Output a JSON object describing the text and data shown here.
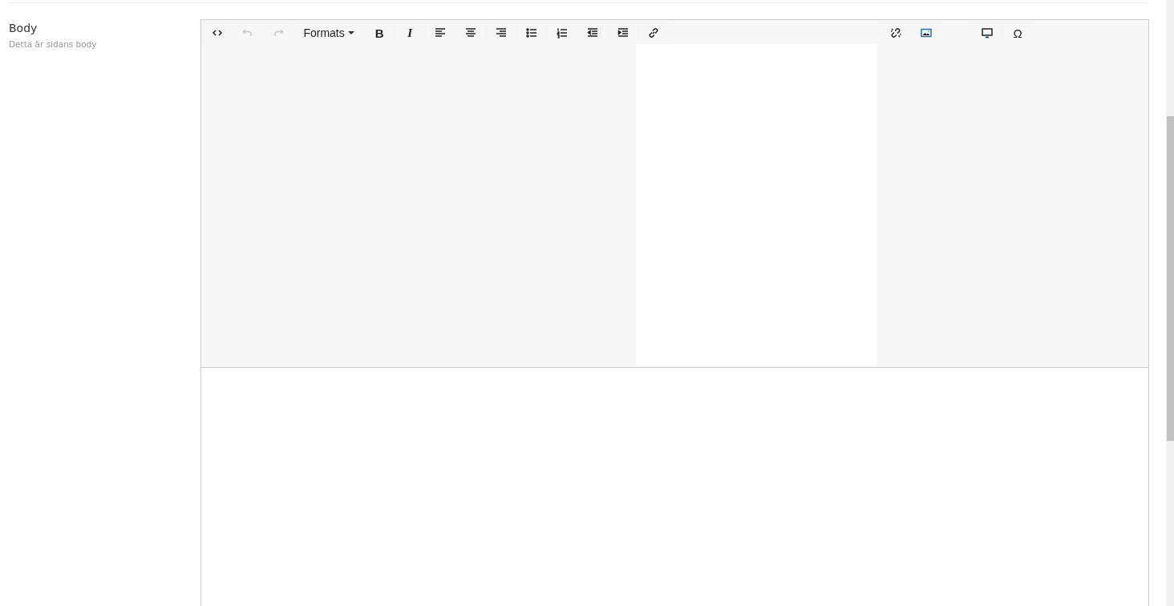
{
  "field": {
    "label": "Body",
    "hint": "Detta är sidans body"
  },
  "toolbar": [
    {
      "group": [
        {
          "kind": "icon",
          "disabled": false
        },
        {
          "kind": "icon",
          "disabled": true
        },
        {
          "kind": "icon",
          "disabled": true
        },
        {
          "kind": "dropdown",
          "label": "Formats",
          "disabled": false
        },
        {
          "kind": "text",
          "label": "B",
          "disabled": false
        },
        {
          "kind": "text",
          "label": "I",
          "disabled": false
        },
        {
          "kind": "icon",
          "disabled": false
        },
        {
          "kind": "icon",
          "disabled": false
        },
        {
          "kind": "icon",
          "disabled": false
        },
        {
          "kind": "icon",
          "disabled": false
        },
        {
          "kind": "icon",
          "disabled": false
        },
        {
          "kind": "icon",
          "disabled": false
        },
        {
          "kind": "icon",
          "disabled": false
        },
        {
          "kind": "icon",
          "disabled": false
        }
      ]
    },
    {
      "group": [
        {
          "kind": "icon",
          "disabled": false
        },
        {
          "kind": "icon",
          "disabled": false
        }
      ]
    },
    {
      "group": [
        {
          "kind": "icon",
          "disabled": false
        },
        {
          "kind": "text",
          "label": "Ω",
          "disabled": false
        }
      ]
    }
  ]
}
